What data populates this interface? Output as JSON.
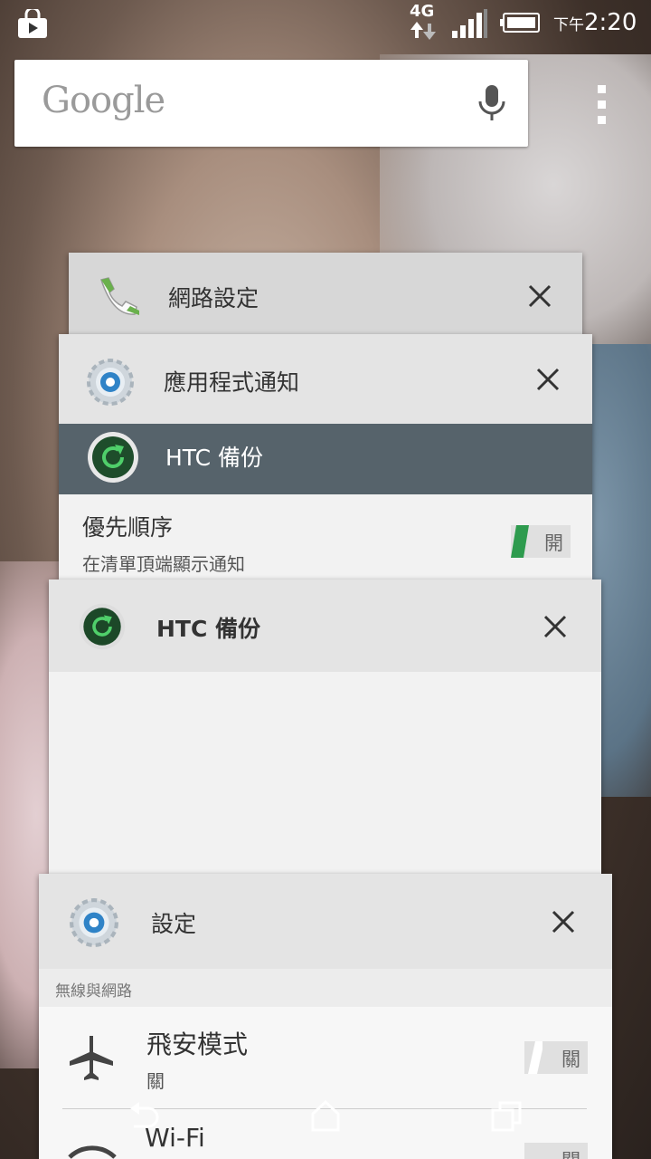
{
  "status_bar": {
    "network": "4G",
    "time_prefix": "下午",
    "time": "2:20"
  },
  "search": {
    "logo": "Google",
    "icons": [
      "mic-icon",
      "overflow-menu-icon"
    ]
  },
  "recent_cards": [
    {
      "title": "網路設定",
      "icon": "phone-icon",
      "close": "close-icon"
    },
    {
      "title": "應用程式通知",
      "icon": "settings-gear-icon",
      "close": "close-icon",
      "content": {
        "app_row": "HTC 備份",
        "option_title": "優先順序",
        "option_subtitle": "在清單頂端顯示通知",
        "toggle": "開"
      }
    },
    {
      "title": "HTC 備份",
      "icon": "htc-backup-icon",
      "close": "close-icon"
    },
    {
      "title": "設定",
      "icon": "settings-gear-icon",
      "close": "close-icon",
      "content": {
        "section": "無線與網路",
        "items": [
          {
            "label": "飛安模式",
            "sub": "關",
            "toggle": "關",
            "icon": "airplane-icon"
          },
          {
            "label": "Wi-Fi",
            "icon": "wifi-icon",
            "toggle": "關"
          }
        ]
      }
    }
  ],
  "navigation": [
    "back-icon",
    "home-icon",
    "recents-icon"
  ],
  "colors": {
    "accent_green": "#2e9b4e",
    "dark_row": "#56636b",
    "card_header": "#e4e4e4",
    "card_body": "#f2f2f2"
  }
}
